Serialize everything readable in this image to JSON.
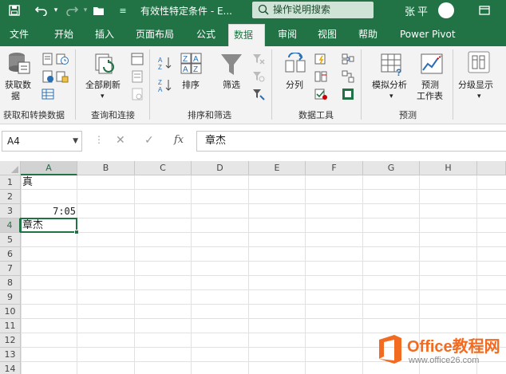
{
  "titlebar": {
    "doc_title": "有效性特定条件 - E...",
    "search_placeholder": "操作说明搜索",
    "user_name": "张平"
  },
  "tabs": [
    "文件",
    "开始",
    "插入",
    "页面布局",
    "公式",
    "数据",
    "审阅",
    "视图",
    "帮助",
    "Power Pivot"
  ],
  "active_tab": "数据",
  "ribbon": {
    "get_data": "获取数",
    "get_data_2": "据",
    "refresh_all": "全部刷新",
    "sort": "排序",
    "filter": "筛选",
    "split": "分列",
    "what_if": "模拟分析",
    "forecast": "预测",
    "forecast_2": "工作表",
    "outline": "分级显示",
    "groups": {
      "get_transform": "获取和转换数据",
      "queries": "查询和连接",
      "sort_filter": "排序和筛选",
      "data_tools": "数据工具",
      "forecast": "预测"
    }
  },
  "formula_bar": {
    "name_box": "A4",
    "fx_label": "fx",
    "content": "章杰"
  },
  "grid": {
    "columns": [
      "A",
      "B",
      "C",
      "D",
      "E",
      "F",
      "G",
      "H"
    ],
    "rows": [
      "1",
      "2",
      "3",
      "4",
      "5",
      "6",
      "7",
      "8",
      "9",
      "10",
      "11",
      "12",
      "13",
      "14"
    ],
    "cells": {
      "A1": "真",
      "A3": "7:05",
      "A4": "章杰"
    },
    "active_cell": "A4"
  },
  "watermark": {
    "brand": "Office教程网",
    "url": "www.office26.com"
  },
  "colors": {
    "excel_green": "#217346",
    "watermark_orange": "#f36b20"
  }
}
